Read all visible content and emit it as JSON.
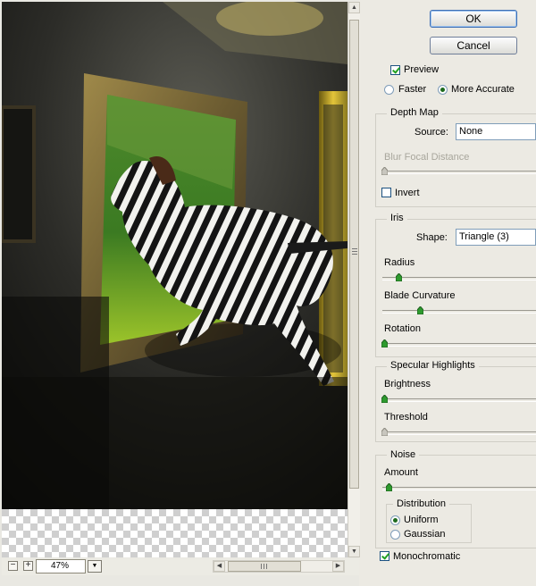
{
  "buttons": {
    "ok": "OK",
    "cancel": "Cancel"
  },
  "preview": {
    "label": "Preview",
    "checked": true,
    "faster": "Faster",
    "more_accurate": "More Accurate",
    "selected": "More Accurate"
  },
  "depth_map": {
    "title": "Depth Map",
    "source_label": "Source:",
    "source_value": "None",
    "blur_focal_label": "Blur Focal Distance",
    "blur_focal_value": 0,
    "invert_label": "Invert",
    "invert_checked": false
  },
  "iris": {
    "title": "Iris",
    "shape_label": "Shape:",
    "shape_value": "Triangle (3)",
    "radius_label": "Radius",
    "radius_value": 9,
    "blade_label": "Blade Curvature",
    "blade_value": 23,
    "rotation_label": "Rotation",
    "rotation_value": 0
  },
  "specular": {
    "title": "Specular Highlights",
    "brightness_label": "Brightness",
    "brightness_value": 0,
    "threshold_label": "Threshold",
    "threshold_value": 0
  },
  "noise": {
    "title": "Noise",
    "amount_label": "Amount",
    "amount_value": 2,
    "distribution_label": "Distribution",
    "uniform": "Uniform",
    "gaussian": "Gaussian",
    "selected": "Uniform",
    "monochromatic_label": "Monochromatic",
    "monochromatic_checked": true
  },
  "zoom": {
    "value": "47%",
    "minus": "−",
    "plus": "+"
  },
  "colors": {
    "ok_border": "#3e6fb4",
    "slider_thumb": "#2e9a2e",
    "panel_bg": "#eceae3"
  }
}
